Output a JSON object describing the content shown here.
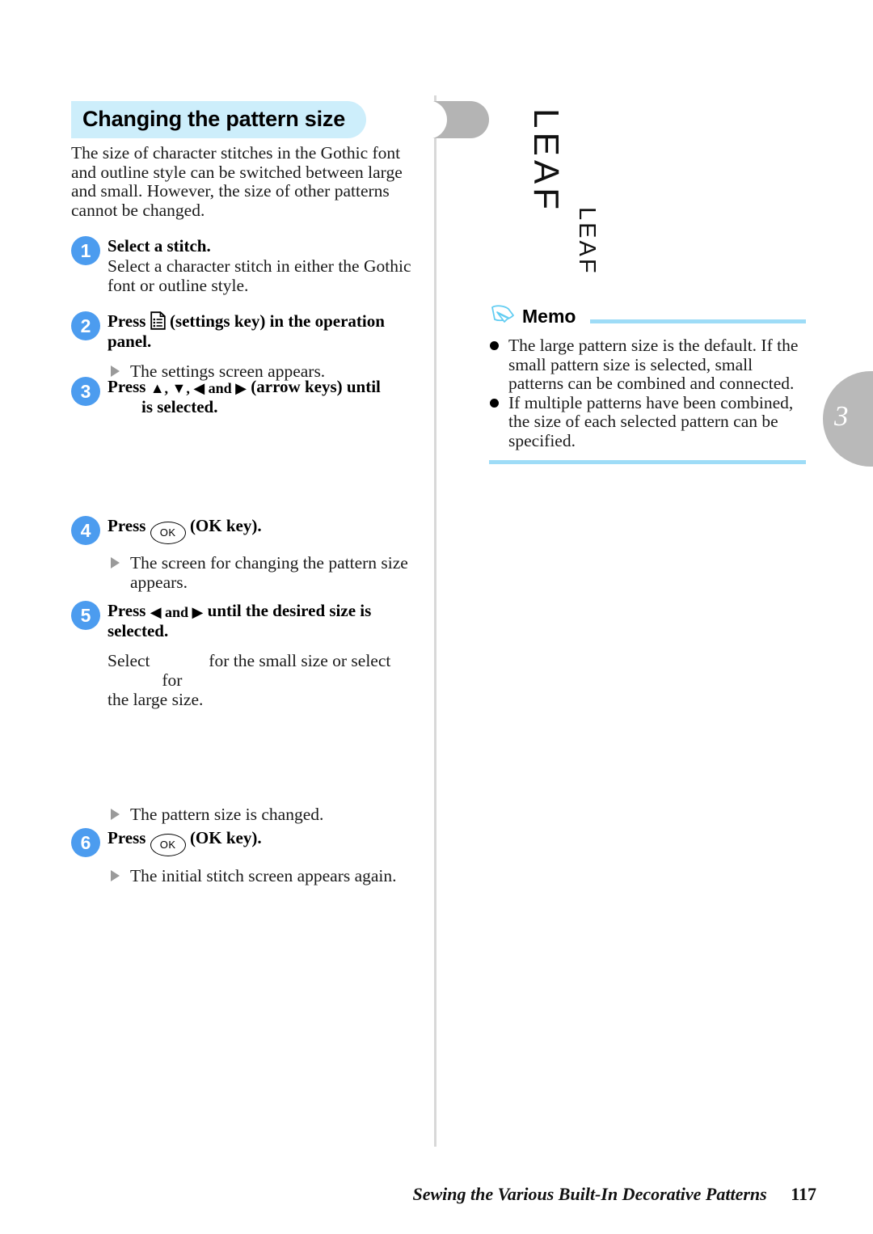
{
  "section": {
    "banner_title": "Changing the pattern size",
    "intro": "The size of character stitches in the Gothic font and outline style can be switched between large and small. However, the size of other patterns cannot be changed."
  },
  "steps": [
    {
      "number": "1",
      "heading": "Select a stitch.",
      "body": "Select a character stitch in either the Gothic font or outline style."
    },
    {
      "number": "2",
      "heading_pre": "Press",
      "icon": "settings-key-icon",
      "heading_post": "(settings key) in the operation panel.",
      "result": "The settings screen appears."
    },
    {
      "number": "3",
      "heading_pre": "Press",
      "arrows": "▲, ▼, ◀ and ▶",
      "heading_post": "(arrow keys) until",
      "heading_line2": "is selected."
    },
    {
      "number": "4",
      "heading_pre": "Press",
      "icon": "ok-key-icon",
      "icon_label": "OK",
      "heading_post": "(OK key).",
      "result": "The screen for changing the pattern size appears."
    },
    {
      "number": "5",
      "heading_pre": "Press",
      "arrows": "◀ and ▶",
      "heading_post": "until the desired size is",
      "heading_line2": "selected.",
      "body_pre": "Select",
      "body_mid": "for the small size or select",
      "body_post": "for",
      "body_line2": "the large size.",
      "result": "The pattern size is changed."
    },
    {
      "number": "6",
      "heading_pre": "Press",
      "icon": "ok-key-icon",
      "icon_label": "OK",
      "heading_post": "(OK key).",
      "result": "The initial stitch screen appears again."
    }
  ],
  "samples": {
    "large_label": "LEAF",
    "small_label": "LEAF"
  },
  "memo": {
    "title": "Memo",
    "items": [
      "The large pattern size is the default. If the small pattern size is selected, small patterns can be combined and connected.",
      "If multiple patterns have been combined, the size of each selected pattern can be specified."
    ]
  },
  "chapter": {
    "number": "3"
  },
  "footer": {
    "title": "Sewing the Various Built-In Decorative Patterns",
    "page_number": "117"
  },
  "colors": {
    "banner_blue": "#cdeefb",
    "banner_gray": "#b4b4b4",
    "badge_blue": "#4c9cef",
    "memo_rule": "#9edcf7",
    "chapter_tab": "#b9b9b9"
  }
}
